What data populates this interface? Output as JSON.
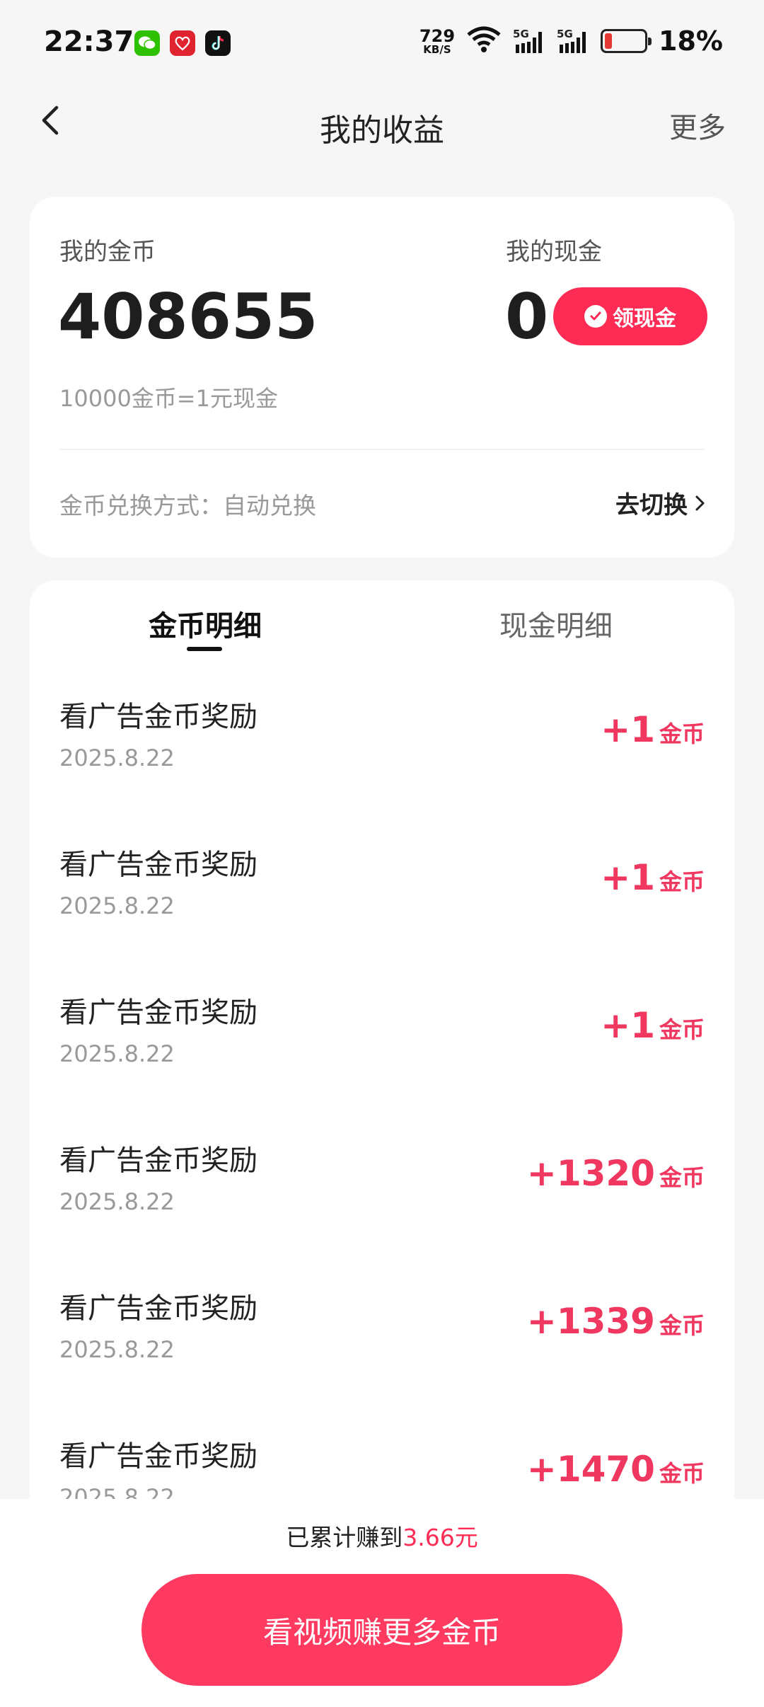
{
  "status_bar": {
    "time": "22:37",
    "net_speed_value": "729",
    "net_speed_unit": "KB/S",
    "signal_1_label": "5G",
    "signal_2_label": "5G",
    "battery_text": "18%",
    "battery_level": 0.18,
    "apps": [
      "wechat-icon",
      "heart-app-icon",
      "tiktok-icon"
    ]
  },
  "nav": {
    "title": "我的收益",
    "more_label": "更多"
  },
  "summary": {
    "coin_label": "我的金币",
    "coin_value": "408655",
    "cash_label": "我的现金",
    "cash_value": "0",
    "claim_button_label": "领现金",
    "rate_text": "10000金币=1元现金",
    "exchange_mode_text": "金币兑换方式：自动兑换",
    "switch_label": "去切换"
  },
  "tabs": [
    {
      "label": "金币明细",
      "active": true
    },
    {
      "label": "现金明细",
      "active": false
    }
  ],
  "records": [
    {
      "title": "看广告金币奖励",
      "date": "2025.8.22",
      "amount": "+1",
      "unit": "金币"
    },
    {
      "title": "看广告金币奖励",
      "date": "2025.8.22",
      "amount": "+1",
      "unit": "金币"
    },
    {
      "title": "看广告金币奖励",
      "date": "2025.8.22",
      "amount": "+1",
      "unit": "金币"
    },
    {
      "title": "看广告金币奖励",
      "date": "2025.8.22",
      "amount": "+1320",
      "unit": "金币"
    },
    {
      "title": "看广告金币奖励",
      "date": "2025.8.22",
      "amount": "+1339",
      "unit": "金币"
    },
    {
      "title": "看广告金币奖励",
      "date": "2025.8.22",
      "amount": "+1470",
      "unit": "金币"
    }
  ],
  "footer": {
    "total_prefix": "已累计赚到",
    "total_amount": "3.66元",
    "cta_label": "看视频赚更多金币"
  },
  "colors": {
    "accent": "#fe2c55",
    "amount": "#f0375f",
    "background": "#f6f6f6"
  }
}
